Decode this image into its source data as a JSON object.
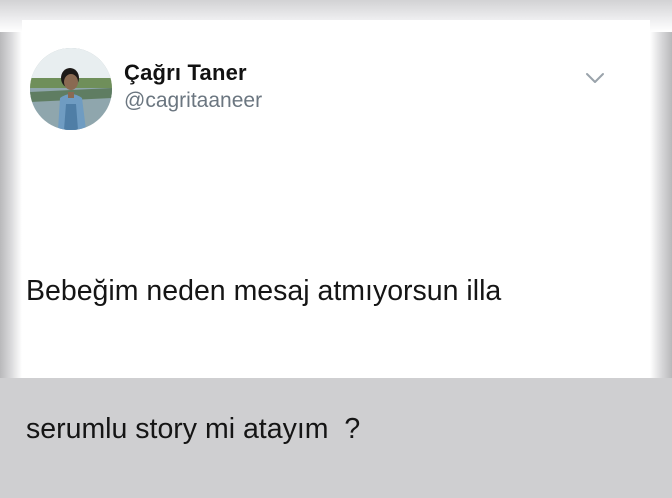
{
  "tweet": {
    "author": {
      "display_name": "Çağrı Taner",
      "handle": "@cagritaaneer",
      "avatar_icon": "profile-photo"
    },
    "menu_icon": "chevron-down-icon",
    "text_lines": [
      "Bebeğim neden mesaj atmıyorsun illa",
      "serumlu story mi atayım  ?"
    ]
  },
  "colors": {
    "name": "#111111",
    "handle": "#6b7680",
    "text": "#151515",
    "chevron": "#9aa3ab"
  }
}
